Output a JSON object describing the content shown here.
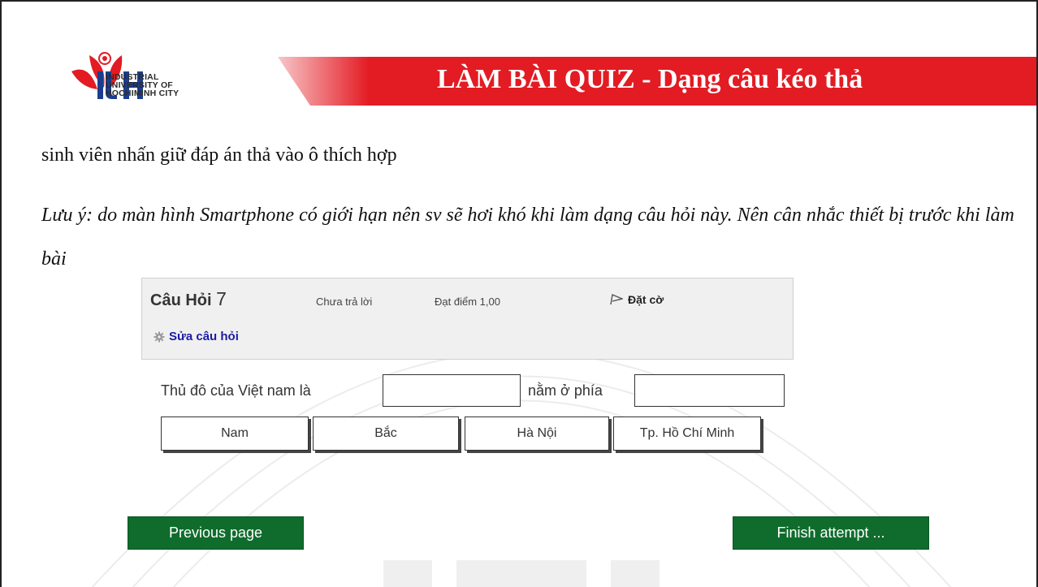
{
  "slide": {
    "title": "LÀM BÀI QUIZ - Dạng câu kéo thả",
    "logo": {
      "lines": [
        "INDUSTRIAL",
        "UNIVERSITY OF",
        "HOCHIMINH CITY"
      ],
      "monogram": "IUH"
    },
    "instruction": "sinh viên nhấn giữ đáp án thả vào ô thích hợp",
    "note": "Lưu ý: do màn hình Smartphone có giới hạn nên sv sẽ hơi khó khi làm dạng câu hỏi này. Nên cân nhắc thiết bị trước khi làm bài",
    "colors": {
      "banner": "#e31b23",
      "button": "#0f6c2c",
      "link": "#1a1aa8"
    }
  },
  "question": {
    "label": "Câu Hỏi",
    "number": "7",
    "state": "Chưa trả lời",
    "grade": "Đạt điểm 1,00",
    "flag_label": "Đặt cờ",
    "edit_label": "Sửa câu hỏi",
    "text_before": "Thủ đô của Việt nam là",
    "text_middle": "nằm ở phía",
    "choices": [
      "Nam",
      "Bắc",
      "Hà Nội",
      "Tp. Hồ Chí Minh"
    ]
  },
  "nav": {
    "previous": "Previous page",
    "finish": "Finish attempt ..."
  }
}
